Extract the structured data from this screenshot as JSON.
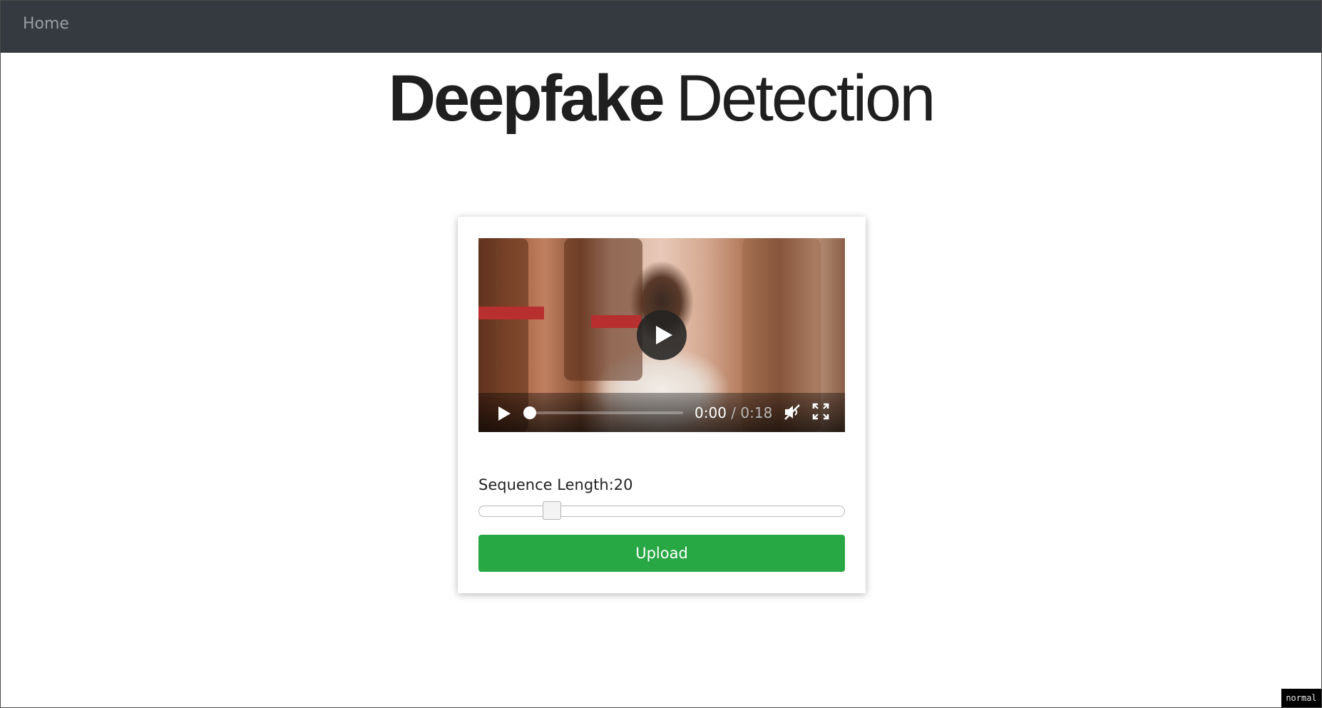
{
  "nav": {
    "home_label": "Home"
  },
  "header": {
    "title_bold": "Deepfake",
    "title_light": "Detection"
  },
  "player": {
    "current_time": "0:00",
    "separator": "/",
    "duration": "0:18",
    "progress": 0,
    "muted": true,
    "icons": [
      "play-icon",
      "mute-icon",
      "fullscreen-icon"
    ]
  },
  "sequence": {
    "label": "Sequence Length:",
    "value": "20",
    "slider_fraction": 0.2
  },
  "upload": {
    "label": "Upload",
    "color": "#28a745"
  },
  "status_badge": "normal",
  "colors": {
    "navbar": "#343a40",
    "accent": "#28a745"
  }
}
